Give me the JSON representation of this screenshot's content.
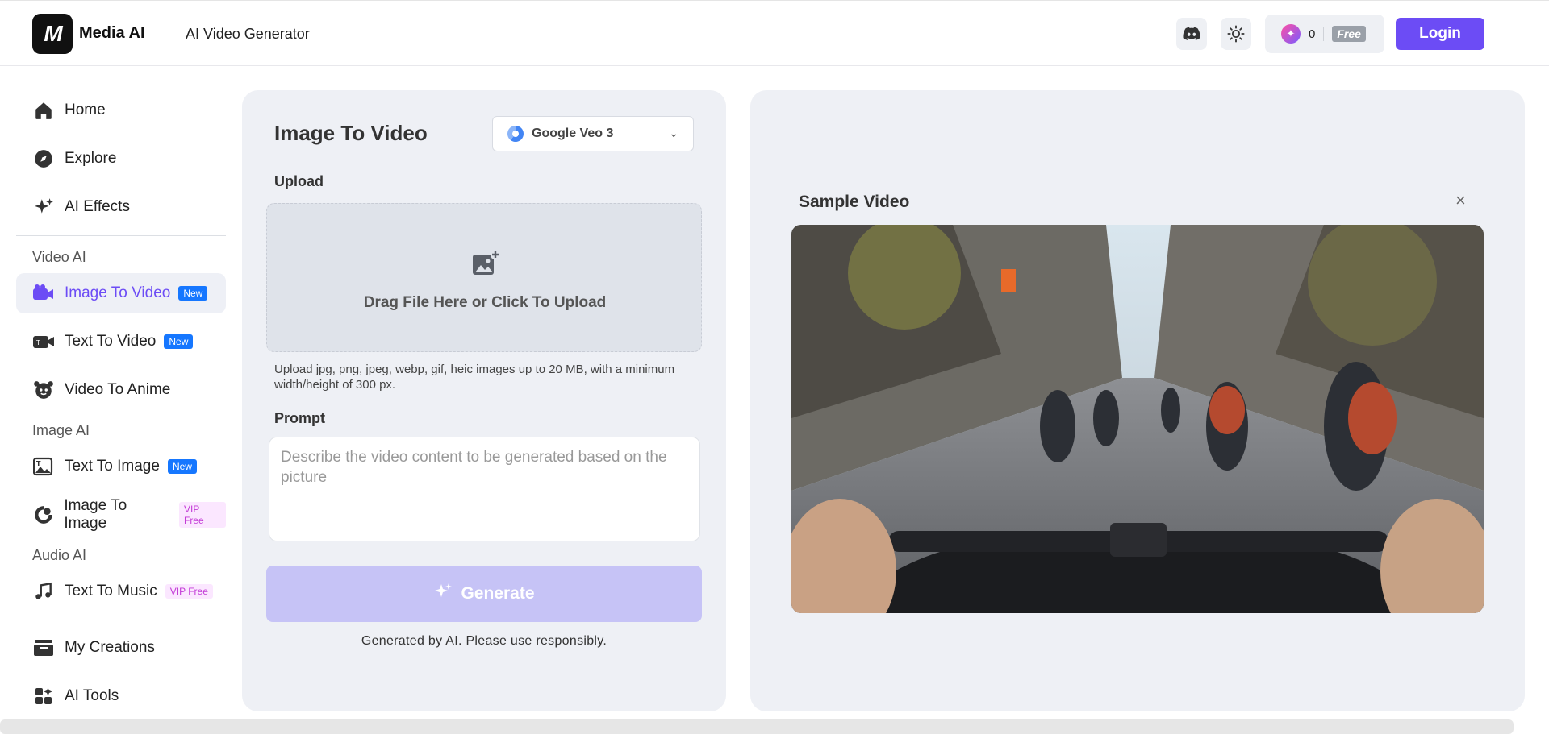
{
  "header": {
    "logo_text": "M",
    "brand": "Media AI",
    "page_title": "AI Video Generator",
    "credits": "0",
    "plan": "Free",
    "login_label": "Login"
  },
  "sidebar": {
    "top_items": [
      {
        "label": "Home",
        "icon": "home-icon"
      },
      {
        "label": "Explore",
        "icon": "compass-icon"
      },
      {
        "label": "AI Effects",
        "icon": "sparkles-icon"
      }
    ],
    "video_section": "Video AI",
    "video_items": [
      {
        "label": "Image To Video",
        "badge": "New",
        "icon": "video-camera-icon"
      },
      {
        "label": "Text To Video",
        "badge": "New",
        "icon": "film-icon"
      },
      {
        "label": "Video To Anime",
        "icon": "anime-face-icon"
      }
    ],
    "image_section": "Image AI",
    "image_items": [
      {
        "label": "Text To Image",
        "badge": "New",
        "icon": "image-text-icon"
      },
      {
        "label": "Image To Image",
        "badge": "VIP Free",
        "icon": "image-transform-icon"
      }
    ],
    "audio_section": "Audio AI",
    "audio_items": [
      {
        "label": "Text To Music",
        "badge": "VIP Free",
        "icon": "music-note-icon"
      }
    ],
    "bottom_items": [
      {
        "label": "My Creations",
        "icon": "creations-icon"
      },
      {
        "label": "AI Tools",
        "icon": "tools-grid-icon"
      }
    ]
  },
  "form": {
    "title": "Image To Video",
    "model": "Google Veo 3",
    "upload_label": "Upload",
    "upload_text": "Drag File Here or Click To Upload",
    "upload_hint": "Upload jpg, png, jpeg, webp, gif, heic images up to 20 MB, with a minimum width/height of 300 px.",
    "prompt_label": "Prompt",
    "prompt_placeholder": "Describe the video content to be generated based on the picture",
    "prompt_value": "",
    "generate_label": "Generate",
    "disclaimer": "Generated by AI. Please use responsibly."
  },
  "sample": {
    "title": "Sample Video",
    "close_label": "×"
  },
  "colors": {
    "accent": "#6c4cf5",
    "new_badge": "#1677ff",
    "vip_badge_text": "#c33bd6",
    "panel_bg": "#eef0f5"
  }
}
